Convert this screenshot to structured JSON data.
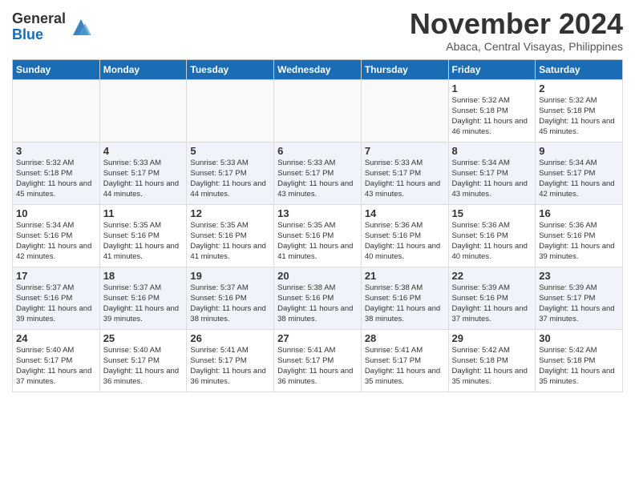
{
  "header": {
    "logo_general": "General",
    "logo_blue": "Blue",
    "month_title": "November 2024",
    "location": "Abaca, Central Visayas, Philippines"
  },
  "days_of_week": [
    "Sunday",
    "Monday",
    "Tuesday",
    "Wednesday",
    "Thursday",
    "Friday",
    "Saturday"
  ],
  "weeks": [
    [
      {
        "day": "",
        "empty": true
      },
      {
        "day": "",
        "empty": true
      },
      {
        "day": "",
        "empty": true
      },
      {
        "day": "",
        "empty": true
      },
      {
        "day": "",
        "empty": true
      },
      {
        "day": "1",
        "sunrise": "5:32 AM",
        "sunset": "5:18 PM",
        "daylight": "11 hours and 46 minutes."
      },
      {
        "day": "2",
        "sunrise": "5:32 AM",
        "sunset": "5:18 PM",
        "daylight": "11 hours and 45 minutes."
      }
    ],
    [
      {
        "day": "3",
        "sunrise": "5:32 AM",
        "sunset": "5:18 PM",
        "daylight": "11 hours and 45 minutes."
      },
      {
        "day": "4",
        "sunrise": "5:33 AM",
        "sunset": "5:17 PM",
        "daylight": "11 hours and 44 minutes."
      },
      {
        "day": "5",
        "sunrise": "5:33 AM",
        "sunset": "5:17 PM",
        "daylight": "11 hours and 44 minutes."
      },
      {
        "day": "6",
        "sunrise": "5:33 AM",
        "sunset": "5:17 PM",
        "daylight": "11 hours and 43 minutes."
      },
      {
        "day": "7",
        "sunrise": "5:33 AM",
        "sunset": "5:17 PM",
        "daylight": "11 hours and 43 minutes."
      },
      {
        "day": "8",
        "sunrise": "5:34 AM",
        "sunset": "5:17 PM",
        "daylight": "11 hours and 43 minutes."
      },
      {
        "day": "9",
        "sunrise": "5:34 AM",
        "sunset": "5:17 PM",
        "daylight": "11 hours and 42 minutes."
      }
    ],
    [
      {
        "day": "10",
        "sunrise": "5:34 AM",
        "sunset": "5:16 PM",
        "daylight": "11 hours and 42 minutes."
      },
      {
        "day": "11",
        "sunrise": "5:35 AM",
        "sunset": "5:16 PM",
        "daylight": "11 hours and 41 minutes."
      },
      {
        "day": "12",
        "sunrise": "5:35 AM",
        "sunset": "5:16 PM",
        "daylight": "11 hours and 41 minutes."
      },
      {
        "day": "13",
        "sunrise": "5:35 AM",
        "sunset": "5:16 PM",
        "daylight": "11 hours and 41 minutes."
      },
      {
        "day": "14",
        "sunrise": "5:36 AM",
        "sunset": "5:16 PM",
        "daylight": "11 hours and 40 minutes."
      },
      {
        "day": "15",
        "sunrise": "5:36 AM",
        "sunset": "5:16 PM",
        "daylight": "11 hours and 40 minutes."
      },
      {
        "day": "16",
        "sunrise": "5:36 AM",
        "sunset": "5:16 PM",
        "daylight": "11 hours and 39 minutes."
      }
    ],
    [
      {
        "day": "17",
        "sunrise": "5:37 AM",
        "sunset": "5:16 PM",
        "daylight": "11 hours and 39 minutes."
      },
      {
        "day": "18",
        "sunrise": "5:37 AM",
        "sunset": "5:16 PM",
        "daylight": "11 hours and 39 minutes."
      },
      {
        "day": "19",
        "sunrise": "5:37 AM",
        "sunset": "5:16 PM",
        "daylight": "11 hours and 38 minutes."
      },
      {
        "day": "20",
        "sunrise": "5:38 AM",
        "sunset": "5:16 PM",
        "daylight": "11 hours and 38 minutes."
      },
      {
        "day": "21",
        "sunrise": "5:38 AM",
        "sunset": "5:16 PM",
        "daylight": "11 hours and 38 minutes."
      },
      {
        "day": "22",
        "sunrise": "5:39 AM",
        "sunset": "5:16 PM",
        "daylight": "11 hours and 37 minutes."
      },
      {
        "day": "23",
        "sunrise": "5:39 AM",
        "sunset": "5:17 PM",
        "daylight": "11 hours and 37 minutes."
      }
    ],
    [
      {
        "day": "24",
        "sunrise": "5:40 AM",
        "sunset": "5:17 PM",
        "daylight": "11 hours and 37 minutes."
      },
      {
        "day": "25",
        "sunrise": "5:40 AM",
        "sunset": "5:17 PM",
        "daylight": "11 hours and 36 minutes."
      },
      {
        "day": "26",
        "sunrise": "5:41 AM",
        "sunset": "5:17 PM",
        "daylight": "11 hours and 36 minutes."
      },
      {
        "day": "27",
        "sunrise": "5:41 AM",
        "sunset": "5:17 PM",
        "daylight": "11 hours and 36 minutes."
      },
      {
        "day": "28",
        "sunrise": "5:41 AM",
        "sunset": "5:17 PM",
        "daylight": "11 hours and 35 minutes."
      },
      {
        "day": "29",
        "sunrise": "5:42 AM",
        "sunset": "5:18 PM",
        "daylight": "11 hours and 35 minutes."
      },
      {
        "day": "30",
        "sunrise": "5:42 AM",
        "sunset": "5:18 PM",
        "daylight": "11 hours and 35 minutes."
      }
    ]
  ]
}
